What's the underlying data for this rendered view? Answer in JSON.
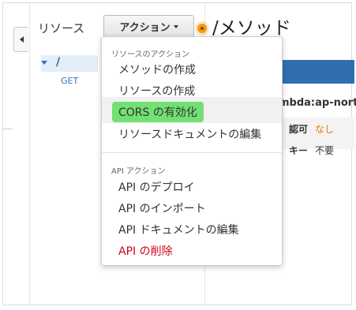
{
  "resources_panel": {
    "title": "リソース",
    "tree": {
      "root_label": "/",
      "child_label": "GET"
    }
  },
  "toolbar": {
    "actions_label": "アクション"
  },
  "method_panel": {
    "title": "/メソッド",
    "arn_fragment": "mbda:ap-nort",
    "auth_label": "認可",
    "auth_value": "なし",
    "api_key_label": "キー",
    "api_key_value": "不要"
  },
  "actions_menu": {
    "resource_actions_header": "リソースのアクション",
    "resource_items": [
      "メソッドの作成",
      "リソースの作成",
      "CORS の有効化",
      "リソースドキュメントの編集"
    ],
    "api_actions_header": "API アクション",
    "api_items": [
      "API のデプロイ",
      "API のインポート",
      "API ドキュメントの編集",
      "API の削除"
    ]
  },
  "colors": {
    "highlight": "#72e072",
    "danger": "#d0021b",
    "accent_orange": "#f29a12",
    "link_blue": "#1f63a8"
  }
}
